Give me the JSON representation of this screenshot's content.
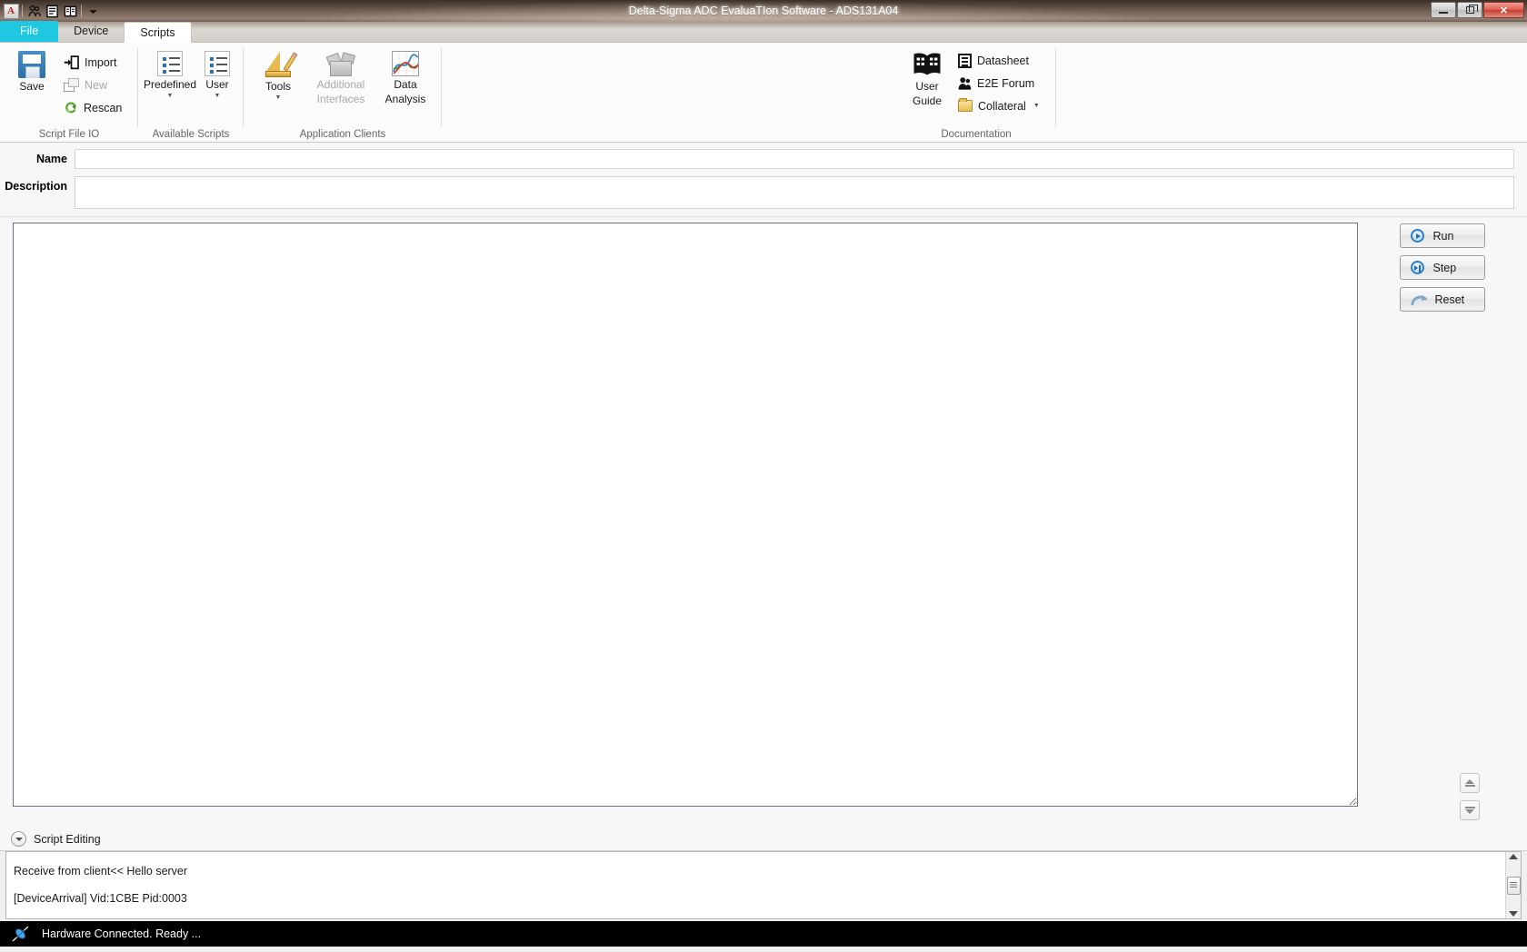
{
  "window": {
    "title": "Delta-Sigma ADC EvaluaTIon Software - ADS131A04",
    "app_icon_letter": "A",
    "controls": {
      "minimize": "minimize-button",
      "restore": "restore-button",
      "close": "✕"
    },
    "quick_access": [
      {
        "name": "people-icon",
        "glyph": "⛟"
      },
      {
        "name": "document-icon",
        "glyph": "▤"
      },
      {
        "name": "book-icon",
        "glyph": "▥"
      },
      {
        "name": "customize-qat-icon",
        "glyph": "▾"
      }
    ]
  },
  "tabs": [
    {
      "label": "File",
      "name": "tab-file",
      "active": false,
      "accent": "#1ec8e0"
    },
    {
      "label": "Device",
      "name": "tab-device",
      "active": false
    },
    {
      "label": "Scripts",
      "name": "tab-scripts",
      "active": true
    }
  ],
  "ribbon": {
    "groups": [
      {
        "label": "Script File IO",
        "big": {
          "label": "Save",
          "icon": "floppy-disk-icon",
          "enabled": true
        },
        "small": [
          {
            "label": "Import",
            "icon": "import-arrow-icon",
            "enabled": true
          },
          {
            "label": "New",
            "icon": "new-file-icon",
            "enabled": false
          },
          {
            "label": "Rescan",
            "icon": "rescan-refresh-icon",
            "enabled": true
          }
        ]
      },
      {
        "label": "Available Scripts",
        "buttons": [
          {
            "label": "Predefined",
            "icon": "bullet-list-icon",
            "dropdown": true,
            "enabled": true
          },
          {
            "label": "User",
            "icon": "bullet-list-icon",
            "dropdown": true,
            "enabled": true
          }
        ]
      },
      {
        "label": "Application Clients",
        "buttons": [
          {
            "label": "Tools",
            "icon": "ruler-pencil-icon",
            "dropdown": true,
            "enabled": true
          },
          {
            "label_line1": "Additional",
            "label_line2": "Interfaces",
            "icon": "open-box-icon",
            "dropdown": true,
            "enabled": false
          },
          {
            "label_line1": "Data",
            "label_line2": "Analysis",
            "icon": "line-chart-icon",
            "enabled": true
          }
        ]
      },
      {
        "label": "Documentation",
        "big": {
          "label_line1": "User",
          "label_line2": "Guide",
          "icon": "open-book-icon",
          "enabled": true
        },
        "small": [
          {
            "label": "Datasheet",
            "icon": "document-sheet-icon",
            "enabled": true
          },
          {
            "label": "E2E Forum",
            "icon": "people-icon",
            "enabled": true
          },
          {
            "label": "Collateral",
            "icon": "folder-icon",
            "dropdown": true,
            "enabled": true
          }
        ]
      }
    ]
  },
  "form": {
    "name_label": "Name",
    "name_value": "",
    "name_placeholder": "",
    "description_label": "Description",
    "description_value": "",
    "description_placeholder": ""
  },
  "editor": {
    "name": "script-editor",
    "value": "",
    "placeholder": ""
  },
  "actions": [
    {
      "label": "Run",
      "name": "run-button",
      "icon": "play-circle-icon"
    },
    {
      "label": "Step",
      "name": "step-button",
      "icon": "step-forward-circle-icon"
    },
    {
      "label": "Reset",
      "name": "reset-button",
      "icon": "reset-arrow-icon"
    }
  ],
  "scroll_nav": [
    {
      "name": "scroll-up-button",
      "icon": "up-triangle-bar-icon"
    },
    {
      "name": "scroll-down-button",
      "icon": "down-triangle-bar-icon"
    }
  ],
  "collapser": {
    "label": "Script Editing",
    "icon": "chevron-down-icon"
  },
  "log": {
    "lines": [
      "Receive from client<< Hello server",
      "[DeviceArrival] Vid:1CBE Pid:0003"
    ]
  },
  "statusbar": {
    "icon": "usb-plug-icon",
    "text": "Hardware Connected.  Ready ..."
  }
}
